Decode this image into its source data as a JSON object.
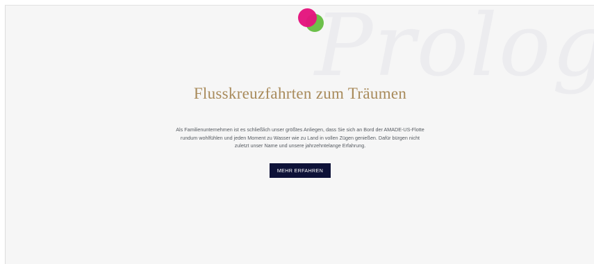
{
  "background_word": "Prolog",
  "logo": {
    "icon": "two-overlapping-dots-logo-icon",
    "colors": {
      "pink": "#e4157e",
      "green": "#6cc04a"
    }
  },
  "hero": {
    "title": "Flusskreuzfahrten zum Träumen",
    "title_color": "#a88a5a",
    "text": "Als Familienunternehmen ist es schließlich unser größtes Anliegen, dass Sie sich an Bord der AMADE-US-Flotte rundum wohlfühlen und jeden Moment zu Wasser wie zu Land in vollen Zügen genießen. Dafür bürgen nicht zuletzt unser Name und unsere jahrzehntelange Erfahrung.",
    "button_label": "MEHR ERFAHREN",
    "button_color": "#0e1238"
  }
}
